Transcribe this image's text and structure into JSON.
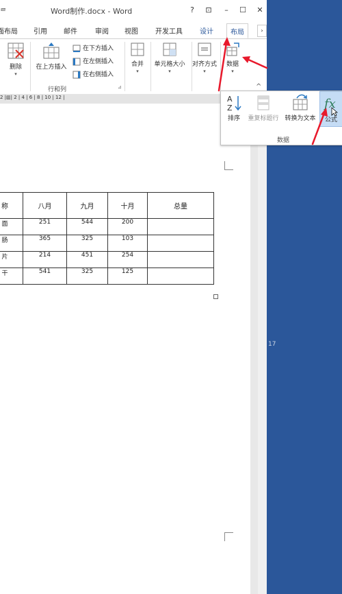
{
  "window": {
    "left_glyph": "ᄅ",
    "title": "Word制作.docx - Word",
    "help": "?",
    "ribbon_display": "⊡",
    "minimize": "–",
    "maximize": "☐",
    "close": "✕"
  },
  "tabs": [
    {
      "label": "页面布局"
    },
    {
      "label": "引用"
    },
    {
      "label": "邮件"
    },
    {
      "label": "审阅"
    },
    {
      "label": "视图"
    },
    {
      "label": "开发工具"
    },
    {
      "label": "设计"
    },
    {
      "label": "布局"
    }
  ],
  "ribbon": {
    "delete": "删除",
    "insert_above": "在上方插入",
    "insert_below": "在下方插入",
    "insert_left": "在左侧插入",
    "insert_right": "在右侧插入",
    "group_rows_cols": "行和列",
    "merge": "合并",
    "cell_size": "单元格大小",
    "alignment": "对齐方式",
    "data": "数据",
    "collapse": "^"
  },
  "ruler": {
    "numbers": "2  |▥|  2  |  4  |  6  |  8  |  10  |  12  |"
  },
  "table": {
    "headers": [
      "称",
      "八月",
      "九月",
      "十月",
      "总量"
    ],
    "rows": [
      [
        "面",
        "251",
        "544",
        "200",
        ""
      ],
      [
        "肠",
        "365",
        "325",
        "103",
        ""
      ],
      [
        "片",
        "214",
        "451",
        "254",
        ""
      ],
      [
        "干",
        "541",
        "325",
        "125",
        ""
      ]
    ]
  },
  "data_popup": {
    "sort": "排序",
    "repeat_header": "重复标题行",
    "convert_to_text": "转换为文本",
    "formula": "公式",
    "group_label": "数据"
  },
  "side_number": "17",
  "colors": {
    "accent": "#2b579a",
    "arrow": "#e8192c",
    "highlight": "#c5dcf5"
  }
}
